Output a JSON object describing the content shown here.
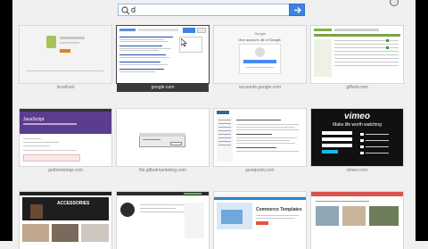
{
  "search": {
    "value": "d"
  },
  "tiles": [
    {
      "label": "localhost"
    },
    {
      "label": "google.com"
    },
    {
      "label": "accounts.google.com"
    },
    {
      "label": "giftedi.com"
    },
    {
      "label": "getbootstrap.com"
    },
    {
      "label": "file.giftedmarketing.com"
    },
    {
      "label": "javatpoint.com"
    },
    {
      "label": "vimeo.com"
    },
    {
      "label": ""
    },
    {
      "label": ""
    },
    {
      "label": ""
    },
    {
      "label": ""
    }
  ],
  "thumb_text": {
    "javascript": "JavaScript",
    "vimeo_logo": "vimeo",
    "vimeo_tagline": "Make life worth watching",
    "accessories": "ACCESSORIES",
    "commerce": "Commerce Templates",
    "google_sign_in": "Google",
    "google_sign_in_sub": "One account. All of Google."
  },
  "colors": {
    "accent": "#3b83e6",
    "active_label_bg": "#3a3a3a",
    "bootstrap_purple": "#5b3d8f",
    "vimeo_bg": "#111111"
  }
}
